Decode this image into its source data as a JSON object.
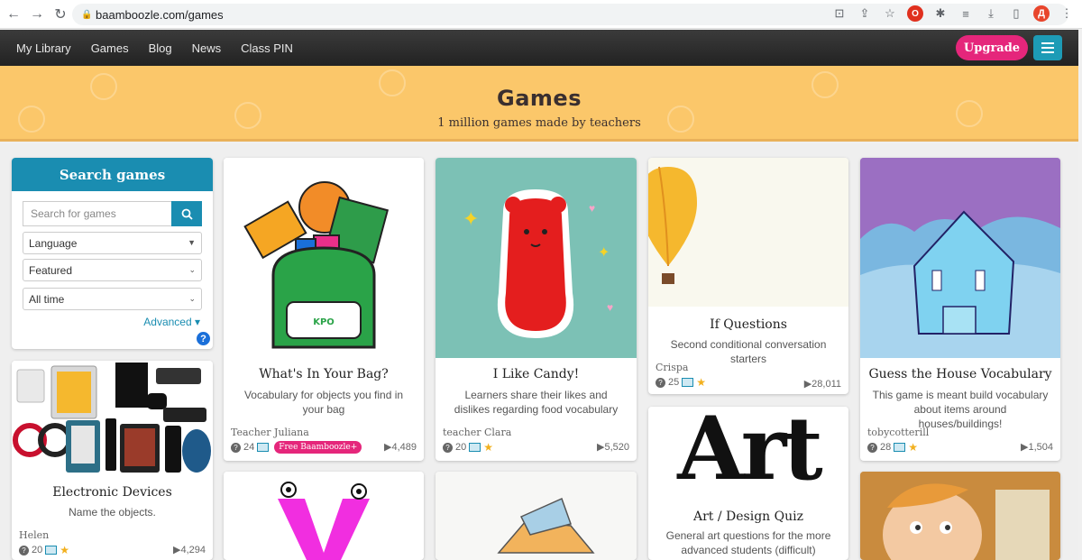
{
  "browser": {
    "url": "baamboozle.com/games",
    "profile_initial": "Д"
  },
  "nav": {
    "items": [
      "My Library",
      "Games",
      "Blog",
      "News",
      "Class PIN"
    ],
    "upgrade_label": "Upgrade"
  },
  "banner": {
    "title": "Games",
    "subtitle": "1 million games made by teachers"
  },
  "search": {
    "heading": "Search games",
    "placeholder": "Search for games",
    "language": "Language",
    "sort": "Featured",
    "period": "All time",
    "advanced": "Advanced ▾",
    "help": "?"
  },
  "cards": [
    {
      "title": "What's In Your Bag?",
      "desc": "Vocabulary for objects you find in your bag",
      "author": "Teacher Juliana",
      "questions": "24",
      "badge": "Free Baamboozle+",
      "plays": "▶4,489",
      "bag_label": "KPO"
    },
    {
      "title": "I Like Candy!",
      "desc": "Learners share their likes and dislikes regarding food vocabulary",
      "author": "teacher Clara",
      "questions": "20",
      "plays": "▶5,520"
    },
    {
      "title": "If Questions",
      "desc": "Second conditional conversation starters",
      "author": "Crispa",
      "questions": "25",
      "plays": "▶28,011"
    },
    {
      "title": "Guess the House Vocabulary",
      "desc": "This game is meant build vocabulary about items around houses/buildings!",
      "author": "tobycotterill",
      "questions": "28",
      "plays": "▶1,504"
    },
    {
      "title": "Electronic Devices",
      "desc": "Name the objects.",
      "author": "Helen",
      "questions": "20",
      "plays": "▶4,294"
    },
    {
      "title": "Art / Design Quiz",
      "desc": "General art questions for the more advanced students (difficult)",
      "image_text": "Art"
    }
  ],
  "colors": {
    "accent": "#1a8db1",
    "upgrade": "#e5267b",
    "banner": "#fbc76a"
  }
}
